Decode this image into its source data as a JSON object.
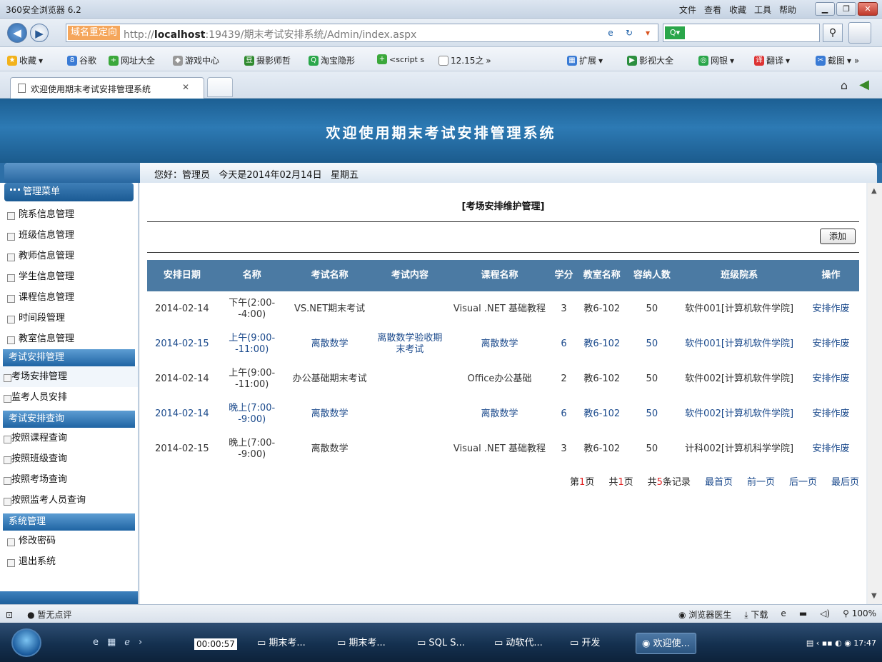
{
  "browser": {
    "app_title": "360安全浏览器 6.2",
    "menu": [
      "文件",
      "查看",
      "收藏",
      "工具",
      "帮助"
    ],
    "redirect_tag": "域名重定向",
    "url_prefix": "http://",
    "url_host": "localhost",
    "url_rest": ":19439/期末考试安排系统/Admin/index.aspx",
    "favorites": [
      "收藏",
      "谷歌",
      "网址大全",
      "游戏中心",
      "摄影师哲",
      "淘宝隐形",
      "<script s",
      "12.15之"
    ],
    "favorites_right": [
      "扩展",
      "影视大全",
      "网银",
      "翻译",
      "截图"
    ],
    "tab_title": "欢迎使用期末考试安排管理系统"
  },
  "header": {
    "title": "欢迎使用期末考试安排管理系统",
    "greeting": "您好：管理员   今天是2014年02月14日   星期五"
  },
  "sidebar": {
    "menu_title": "管理菜单",
    "group1": [
      "院系信息管理",
      "班级信息管理",
      "教师信息管理",
      "学生信息管理",
      "课程信息管理",
      "时间段管理",
      "教室信息管理"
    ],
    "section_arrange": "考试安排管理",
    "group2": [
      "考场安排管理",
      "监考人员安排"
    ],
    "section_query": "考试安排查询",
    "group3": [
      "按照课程查询",
      "按照班级查询",
      "按照考场查询",
      "按照监考人员查询"
    ],
    "section_system": "系统管理",
    "group4": [
      "修改密码",
      "退出系统"
    ]
  },
  "main": {
    "page_title": "[考场安排维护管理]",
    "add_label": "添加",
    "columns": [
      "安排日期",
      "名称",
      "考试名称",
      "考试内容",
      "课程名称",
      "学分",
      "教室名称",
      "容纳人数",
      "班级院系",
      "操作"
    ],
    "rows": [
      [
        "2014-02-14",
        "下午(2:00--4:00)",
        "VS.NET期末考试",
        "",
        "Visual .NET 基础教程",
        "3",
        "教6-102",
        "50",
        "软件001[计算机软件学院]",
        "安排作废"
      ],
      [
        "2014-02-15",
        "上午(9:00--11:00)",
        "离散数学",
        "离散数学验收期末考试",
        "离散数学",
        "6",
        "教6-102",
        "50",
        "软件001[计算机软件学院]",
        "安排作废"
      ],
      [
        "2014-02-14",
        "上午(9:00--11:00)",
        "办公基础期末考试",
        "",
        "Office办公基础",
        "2",
        "教6-102",
        "50",
        "软件002[计算机软件学院]",
        "安排作废"
      ],
      [
        "2014-02-14",
        "晚上(7:00--9:00)",
        "离散数学",
        "",
        "离散数学",
        "6",
        "教6-102",
        "50",
        "软件002[计算机软件学院]",
        "安排作废"
      ],
      [
        "2014-02-15",
        "晚上(7:00--9:00)",
        "离散数学",
        "",
        "Visual .NET 基础教程",
        "3",
        "教6-102",
        "50",
        "计科002[计算机科学学院]",
        "安排作废"
      ]
    ],
    "pager": {
      "page_prefix": "第",
      "page_num": "1",
      "page_suffix": "页",
      "total_prefix": "共",
      "total_num": "1",
      "total_suffix": "页",
      "rec_prefix": "共",
      "rec_num": "5",
      "rec_suffix": "条记录",
      "first": "最首页",
      "prev": "前一页",
      "next": "后一页",
      "last": "最后页"
    }
  },
  "statusbar": {
    "rating": "暂无点评",
    "doctor": "浏览器医生",
    "download": "下载",
    "zoom": "100%"
  },
  "taskbar": {
    "timer": "00:00:57",
    "tasks": [
      "期末考...",
      "期末考...",
      "SQL S...",
      "动软代...",
      "开发",
      "欢迎使..."
    ],
    "clock": "17:47"
  }
}
